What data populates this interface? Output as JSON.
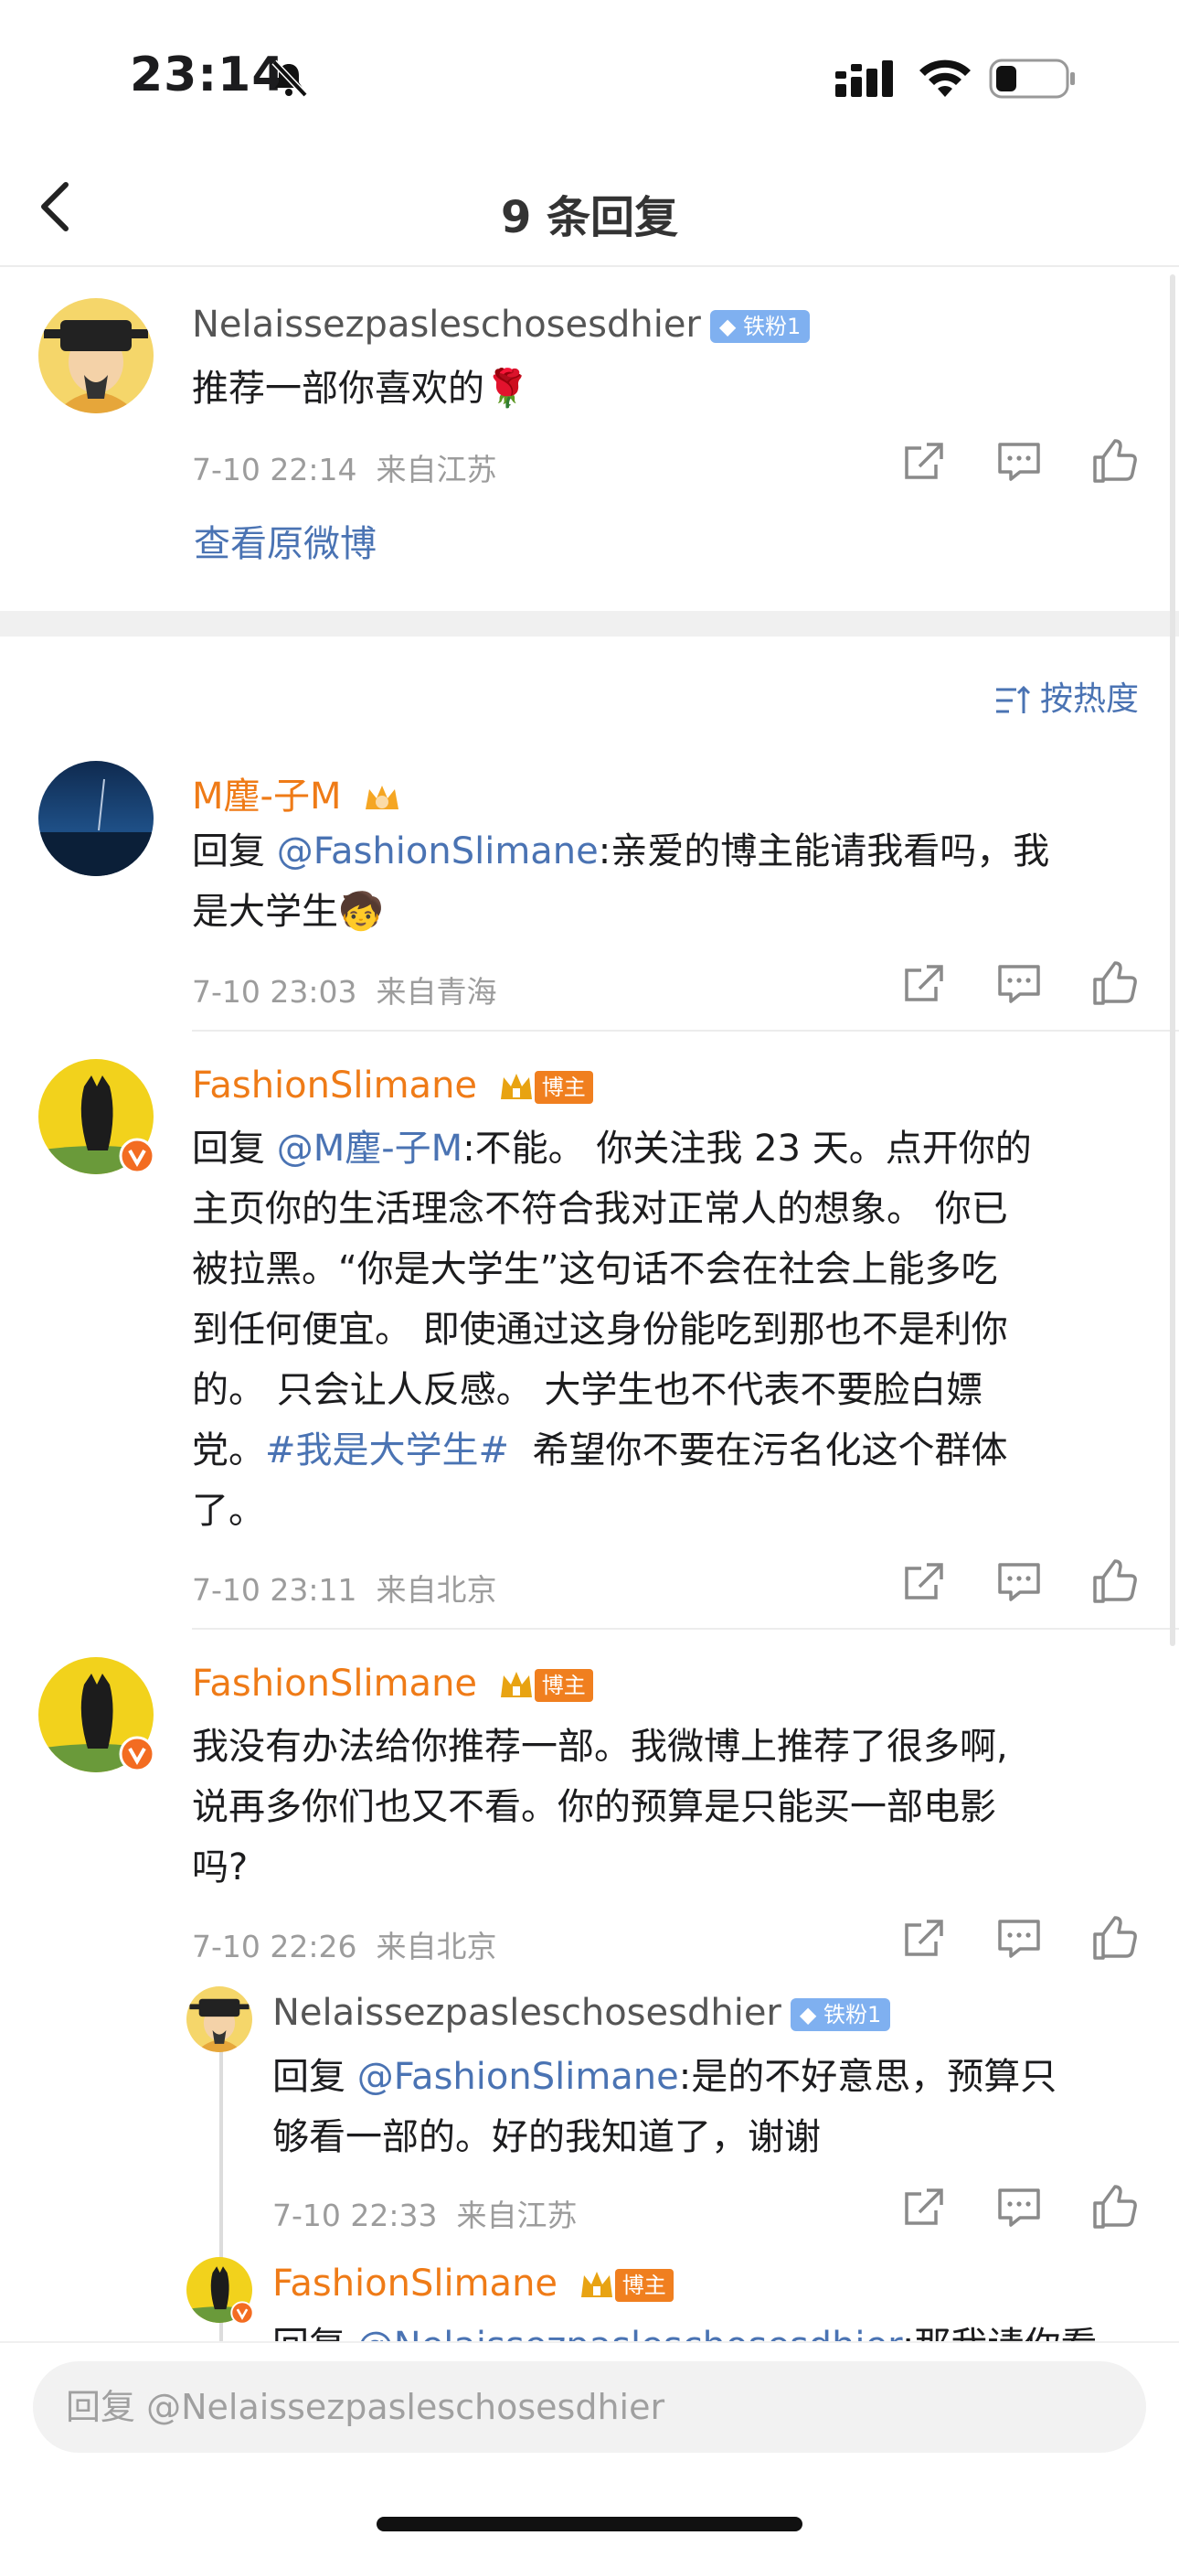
{
  "status": {
    "time": "23:14"
  },
  "nav": {
    "title": "9 条回复"
  },
  "original": {
    "username": "Nelaissezpasleschosesdhier",
    "badge": "铁粉1",
    "text": "推荐一部你喜欢的",
    "text_emoji": "🌹",
    "time": "7-10 22:14",
    "location": "来自江苏",
    "view_link": "查看原微博"
  },
  "sort_label": "按热度",
  "comments": [
    {
      "username": "M麈-子M",
      "reply_prefix": "回复 ",
      "mention": "@FashionSlimane",
      "text_line1": ":亲爱的博主能请我看吗，我",
      "text_line2": "是大学生",
      "emoji": "🧒",
      "time": "7-10 23:03",
      "location": "来自青海"
    },
    {
      "username": "FashionSlimane",
      "badge": "博主",
      "reply_prefix": "回复 ",
      "mention": "@M麈-子M",
      "text_lines": [
        ":不能。 你关注我 23 天。点开你的",
        "主页你的生活理念不符合我对正常人的想象。 你已",
        "被拉黑。“你是大学生”这句话不会在社会上能多吃",
        "到任何便宜。 即使通过这身份能吃到那也不是利你",
        "的。 只会让人反感。 大学生也不代表不要脸白嫖"
      ],
      "line6_prefix": "党。",
      "hashtag": "#我是大学生#",
      "line6_suffix": "  希望你不要在污名化这个群体",
      "line7": "了。",
      "time": "7-10 23:11",
      "location": "来自北京"
    },
    {
      "username": "FashionSlimane",
      "badge": "博主",
      "text_lines": [
        "我没有办法给你推荐一部。我微博上推荐了很多啊,",
        "说再多你们也又不看。你的预算是只能买一部电影",
        "吗?"
      ],
      "time": "7-10 22:26",
      "location": "来自北京"
    }
  ],
  "subreplies": [
    {
      "username": "Nelaissezpasleschosesdhier",
      "badge": "铁粉1",
      "reply_prefix": "回复 ",
      "mention": "@FashionSlimane",
      "text_line1": ":是的不好意思，预算只",
      "text_line2": "够看一部的。好的我知道了，谢谢",
      "time": "7-10 22:33",
      "location": "来自江苏"
    },
    {
      "username": "FashionSlimane",
      "badge": "博主",
      "reply_prefix": "回复 ",
      "mention": "@Nelaissezpasleschosesdhier",
      "text_tail": ":那我请你看"
    }
  ],
  "input": {
    "placeholder": "回复 @Nelaissezpasleschosesdhier"
  },
  "colors": {
    "link": "#4a73b3",
    "orange_name": "#ef7b17",
    "iron_badge": "#7fb0f0",
    "boss_badge": "#f07f1f"
  }
}
